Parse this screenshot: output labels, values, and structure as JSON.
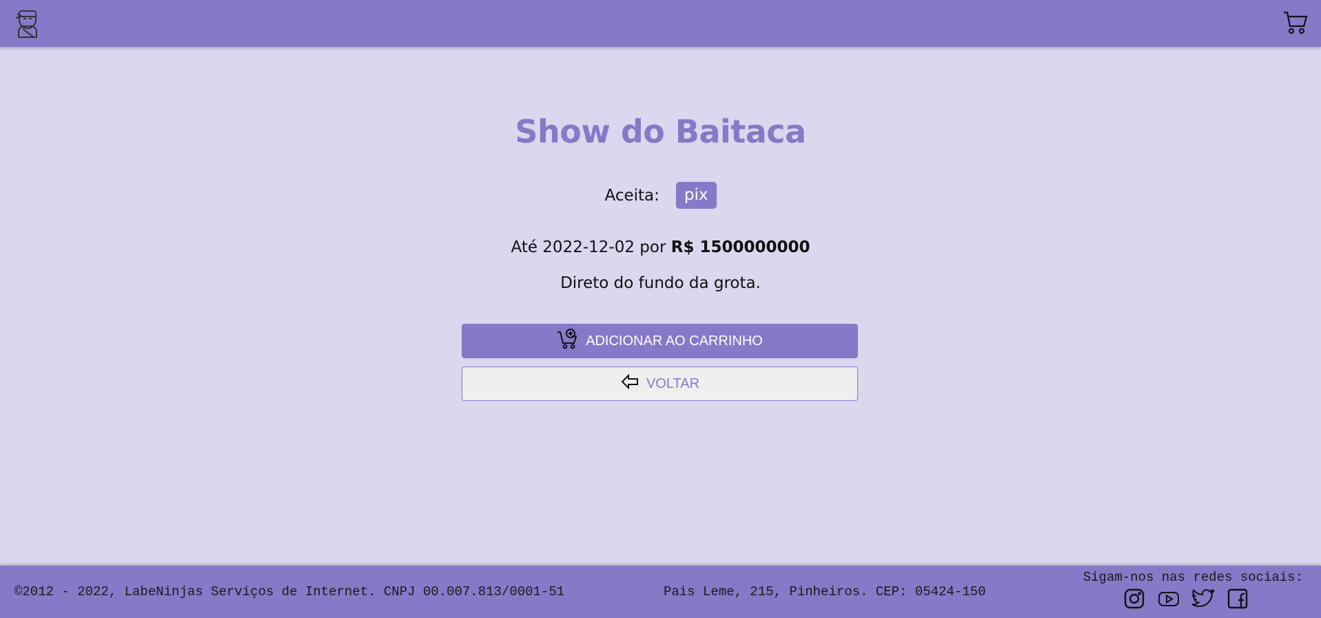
{
  "header": {
    "logo_icon": "ninja-logo-icon",
    "cart_icon": "cart-icon"
  },
  "service": {
    "title": "Show do Baitaca",
    "accepts_label": "Aceita:",
    "payment_methods": [
      "pix"
    ],
    "deadline_prefix": "Até",
    "deadline": "2022-12-02",
    "price_connector": "por",
    "price": "R$ 1500000000",
    "description": "Direto do fundo da grota."
  },
  "actions": {
    "add_to_cart_label": "ADICIONAR AO CARRINHO",
    "add_to_cart_icon": "cart-plus-icon",
    "back_label": "VOLTAR",
    "back_icon": "arrow-left-icon"
  },
  "footer": {
    "copyright": "©2012 - 2022, LabeNinjas Serviços de Internet. CNPJ 00.007.813/0001-51",
    "address": "Pais Leme, 215, Pinheiros. CEP: 05424-150",
    "social_title": "Sigam-nos nas redes sociais:",
    "social_icons": [
      "instagram-icon",
      "youtube-icon",
      "twitter-icon",
      "facebook-icon"
    ]
  },
  "colors": {
    "primary": "#8878c8",
    "background": "#dcd6ee",
    "back_button_bg": "#efefef"
  }
}
